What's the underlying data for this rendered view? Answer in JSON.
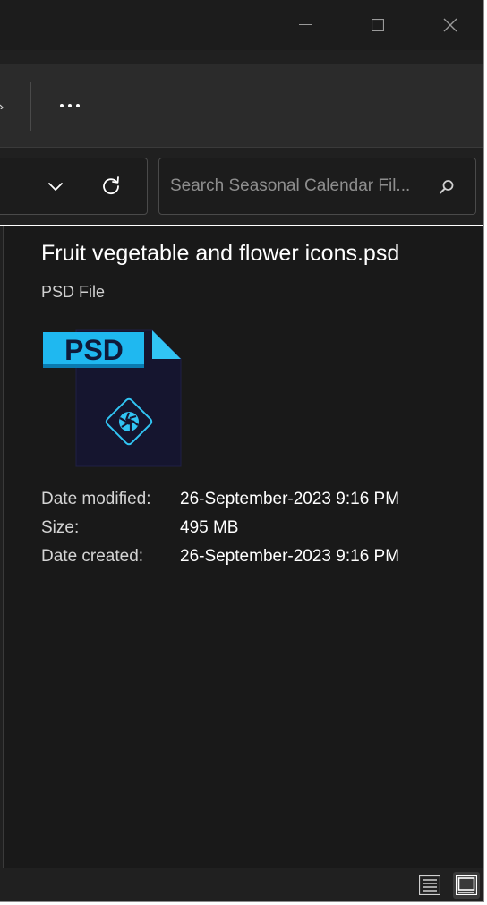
{
  "window": {
    "controls": [
      "minimize",
      "maximize",
      "close"
    ]
  },
  "toolbar": {
    "more_label": "..."
  },
  "search": {
    "placeholder": "Search Seasonal Calendar Fil..."
  },
  "preview": {
    "file_name": "Fruit vegetable and flower icons.psd",
    "file_type": "PSD File",
    "icon": {
      "name": "psd-file-icon",
      "badge_text": "PSD",
      "badge_color": "#1fb8f0",
      "body_color": "#15152f",
      "accent_color": "#31c5f4"
    },
    "details": [
      {
        "label": "Date modified:",
        "value": "26-September-2023 9:16 PM"
      },
      {
        "label": "Size:",
        "value": "495 MB"
      },
      {
        "label": "Date created:",
        "value": "26-September-2023 9:16 PM"
      }
    ]
  },
  "statusbar": {
    "views": [
      "details-view",
      "large-icons-view"
    ],
    "active_view": "large-icons-view"
  }
}
